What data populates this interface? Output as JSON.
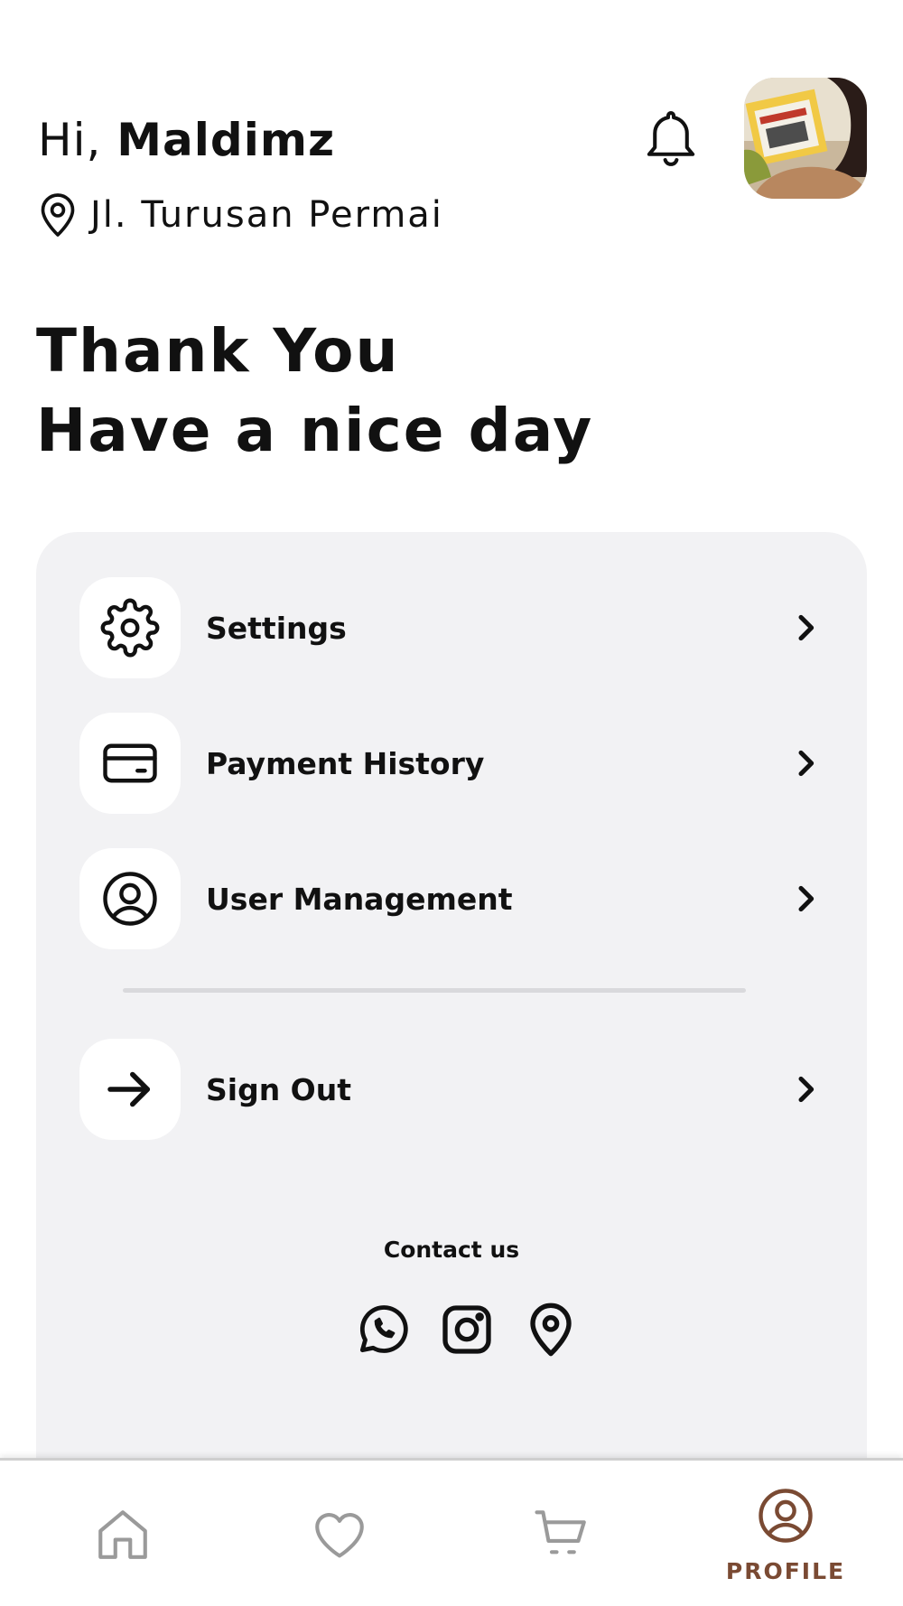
{
  "header": {
    "greeting_prefix": "Hi,",
    "user_name": "Maldimz",
    "location": "Jl. Turusan Permai",
    "notification_icon": "bell-icon",
    "avatar_icon": "user-avatar-photo"
  },
  "hero": {
    "line1": "Thank You",
    "line2": "Have a nice day"
  },
  "menu": {
    "items": [
      {
        "label": "Settings",
        "icon": "gear-icon"
      },
      {
        "label": "Payment History",
        "icon": "credit-card-icon"
      },
      {
        "label": "User Management",
        "icon": "user-circle-icon"
      },
      {
        "label": "Sign Out",
        "icon": "arrow-right-icon"
      }
    ]
  },
  "contact": {
    "title": "Contact us",
    "icons": [
      "whatsapp-icon",
      "instagram-icon",
      "map-pin-icon"
    ]
  },
  "bottom_nav": {
    "items": [
      {
        "icon": "home-icon",
        "label": ""
      },
      {
        "icon": "heart-icon",
        "label": ""
      },
      {
        "icon": "cart-icon",
        "label": ""
      },
      {
        "icon": "profile-icon",
        "label": "PROFILE",
        "active": true
      }
    ]
  },
  "colors": {
    "text": "#111111",
    "panel_bg": "#f2f2f4",
    "active_accent": "#7a4a33",
    "inactive_icon": "#9a9a9a"
  }
}
